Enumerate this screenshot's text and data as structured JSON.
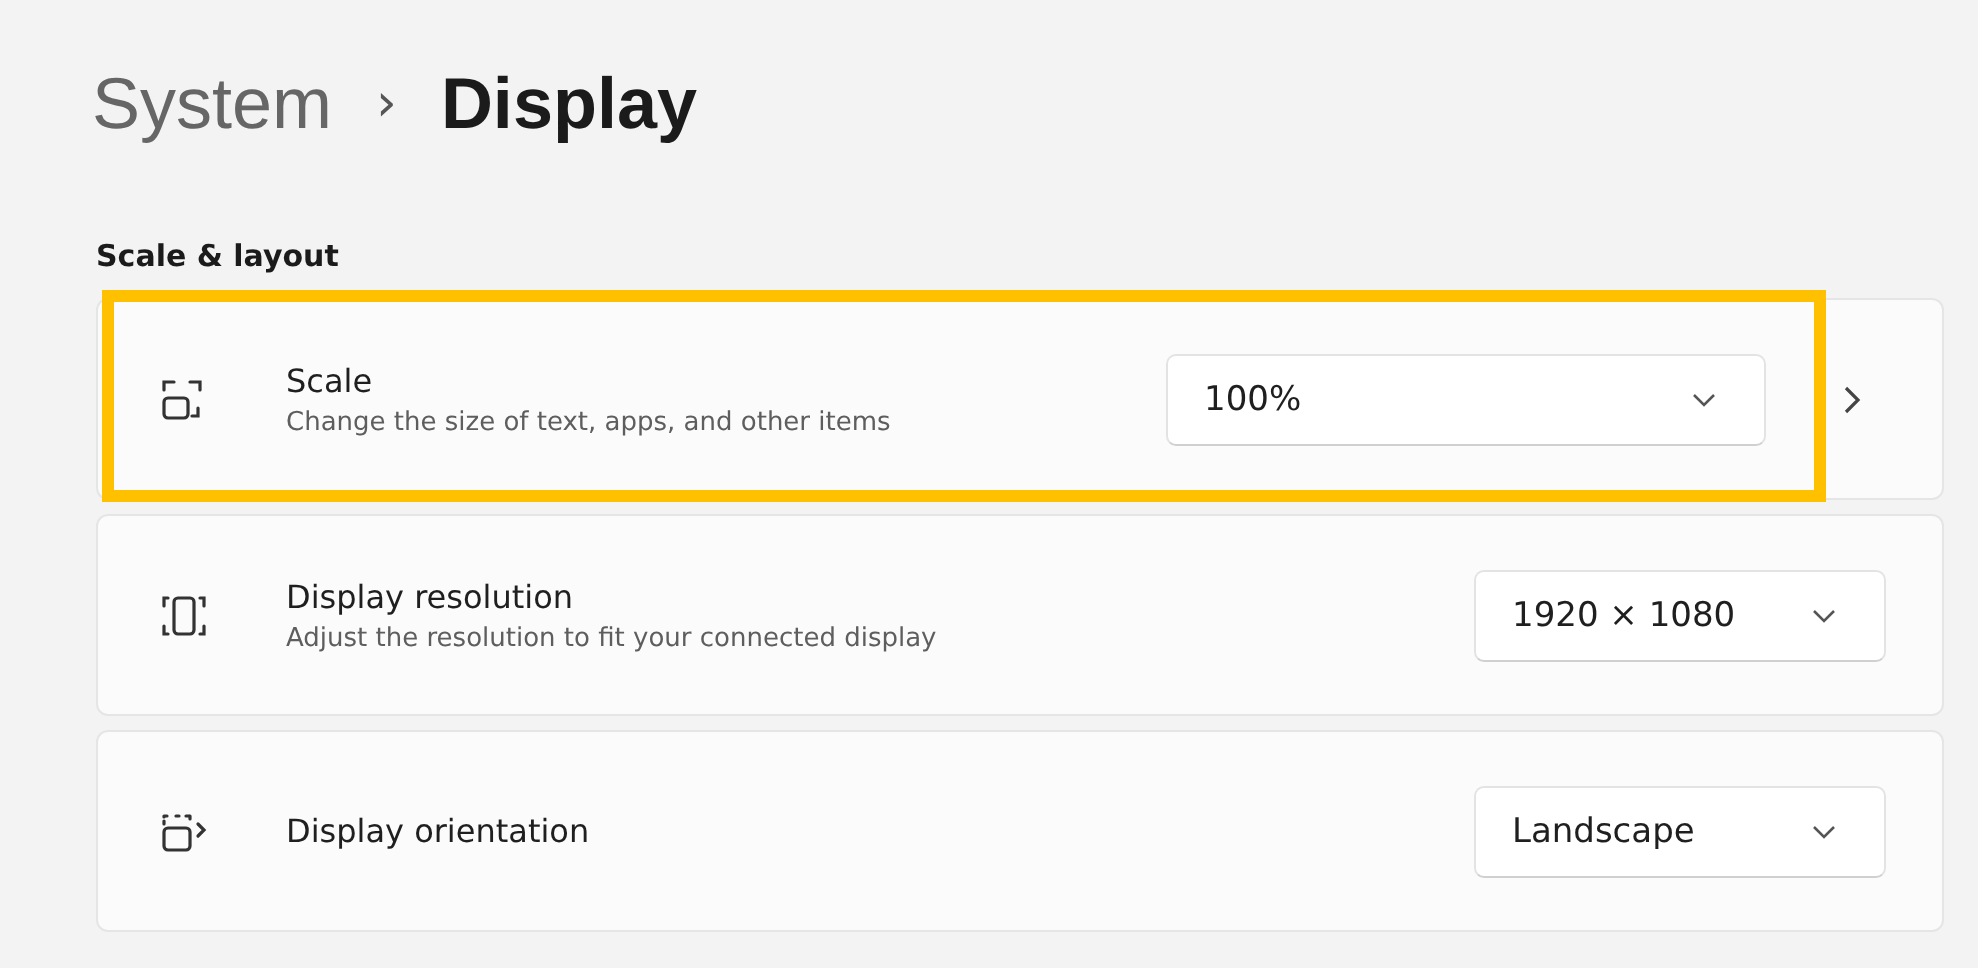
{
  "breadcrumb": {
    "parent": "System",
    "separator": "›",
    "current": "Display"
  },
  "section": "Scale & layout",
  "settings": [
    {
      "kind": "scale",
      "title": "Scale",
      "description": "Change the size of text, apps, and other items",
      "value": "100%",
      "wide": true,
      "navigates": true,
      "highlighted": true
    },
    {
      "kind": "resolution",
      "title": "Display resolution",
      "description": "Adjust the resolution to fit your connected display",
      "value": "1920 × 1080",
      "wide": false,
      "navigates": false,
      "highlighted": false
    },
    {
      "kind": "orientation",
      "title": "Display orientation",
      "value": "Landscape",
      "wide": false,
      "navigates": false,
      "highlighted": false
    }
  ]
}
